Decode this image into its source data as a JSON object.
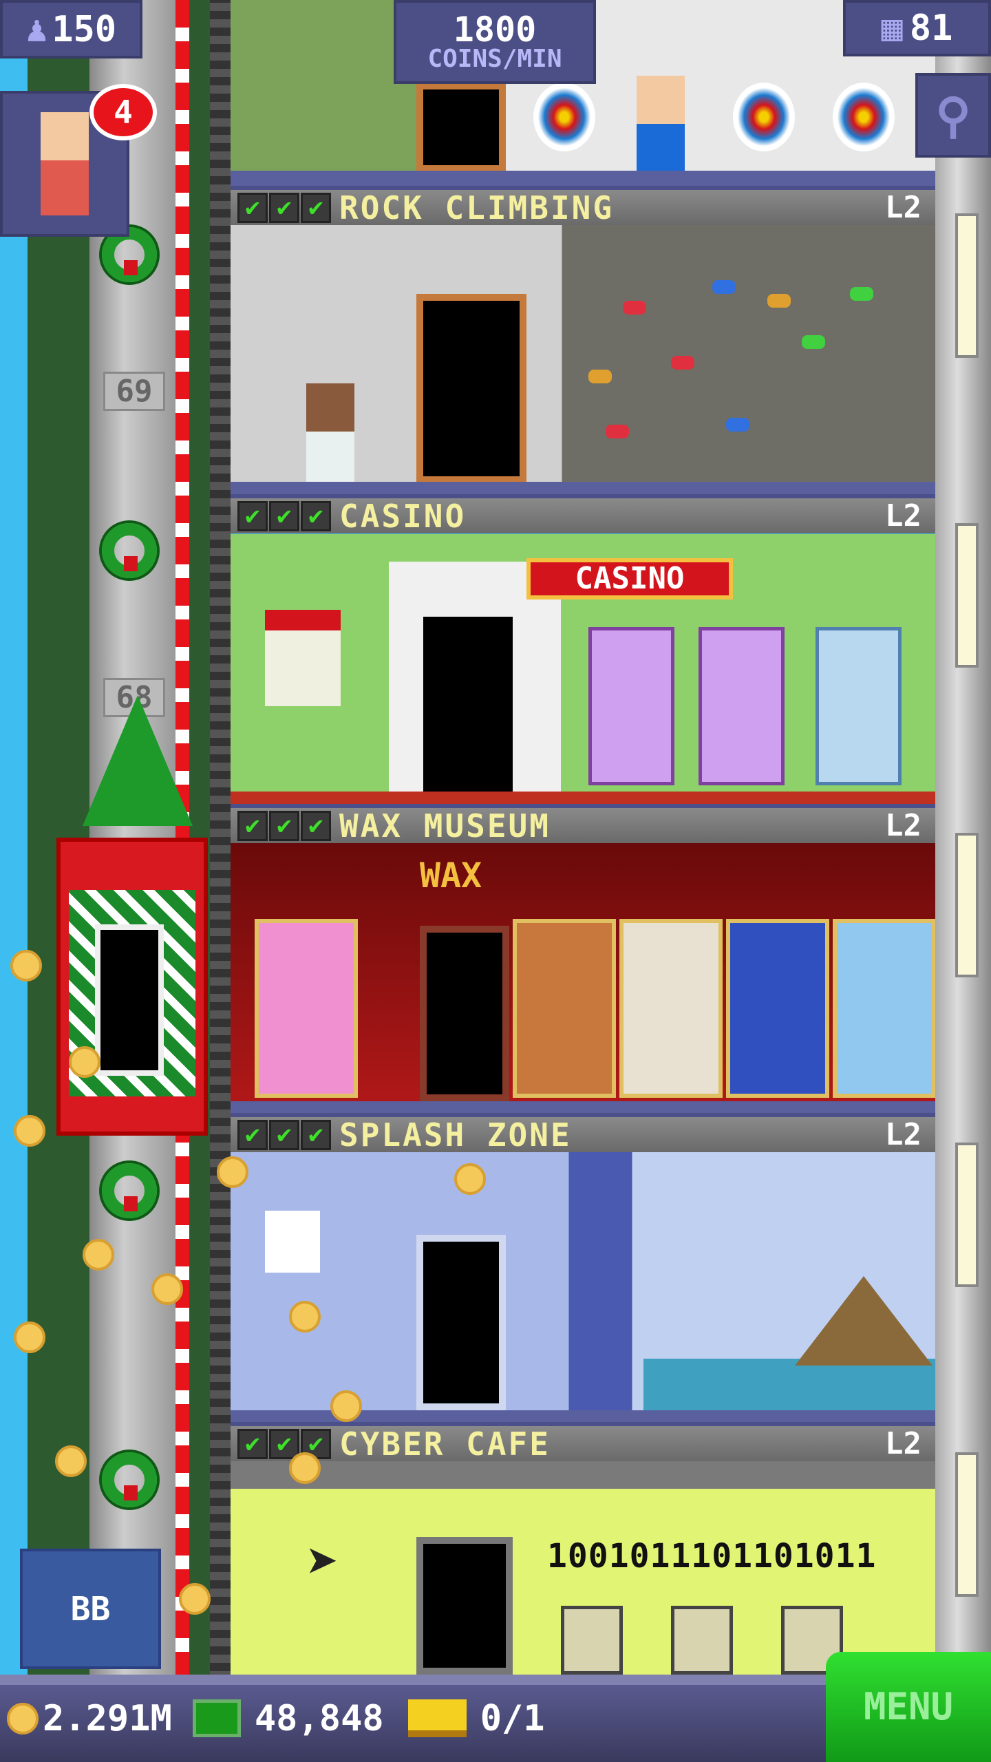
{
  "hud": {
    "population": "150",
    "coins_per_min_value": "1800",
    "coins_per_min_label": "COINS/MIN",
    "floors_count": "81",
    "notification_count": "4"
  },
  "elevator": {
    "floor_numbers": [
      "69",
      "68"
    ]
  },
  "floors": [
    {
      "name": "ROCK CLIMBING",
      "level": "L2",
      "checks": "✔"
    },
    {
      "name": "CASINO",
      "level": "L2",
      "checks": "✔"
    },
    {
      "name": "WAX MUSEUM",
      "level": "L2",
      "checks": "✔"
    },
    {
      "name": "SPLASH ZONE",
      "level": "L2",
      "checks": "✔"
    },
    {
      "name": "CYBER CAFE",
      "level": "L2",
      "checks": "✔"
    }
  ],
  "signs": {
    "casino": "CASINO",
    "wax": "WAX",
    "binary": "1001011101101011"
  },
  "bottom_bar": {
    "coins": "2.291M",
    "bux": "48,848",
    "tickets": "0/1",
    "menu_label": "MENU",
    "bb_label": "BB"
  },
  "colors": {
    "header_text": "#f4f0a0",
    "menu_green": "#1fbf2a",
    "hud_bg": "#4b4f86"
  }
}
